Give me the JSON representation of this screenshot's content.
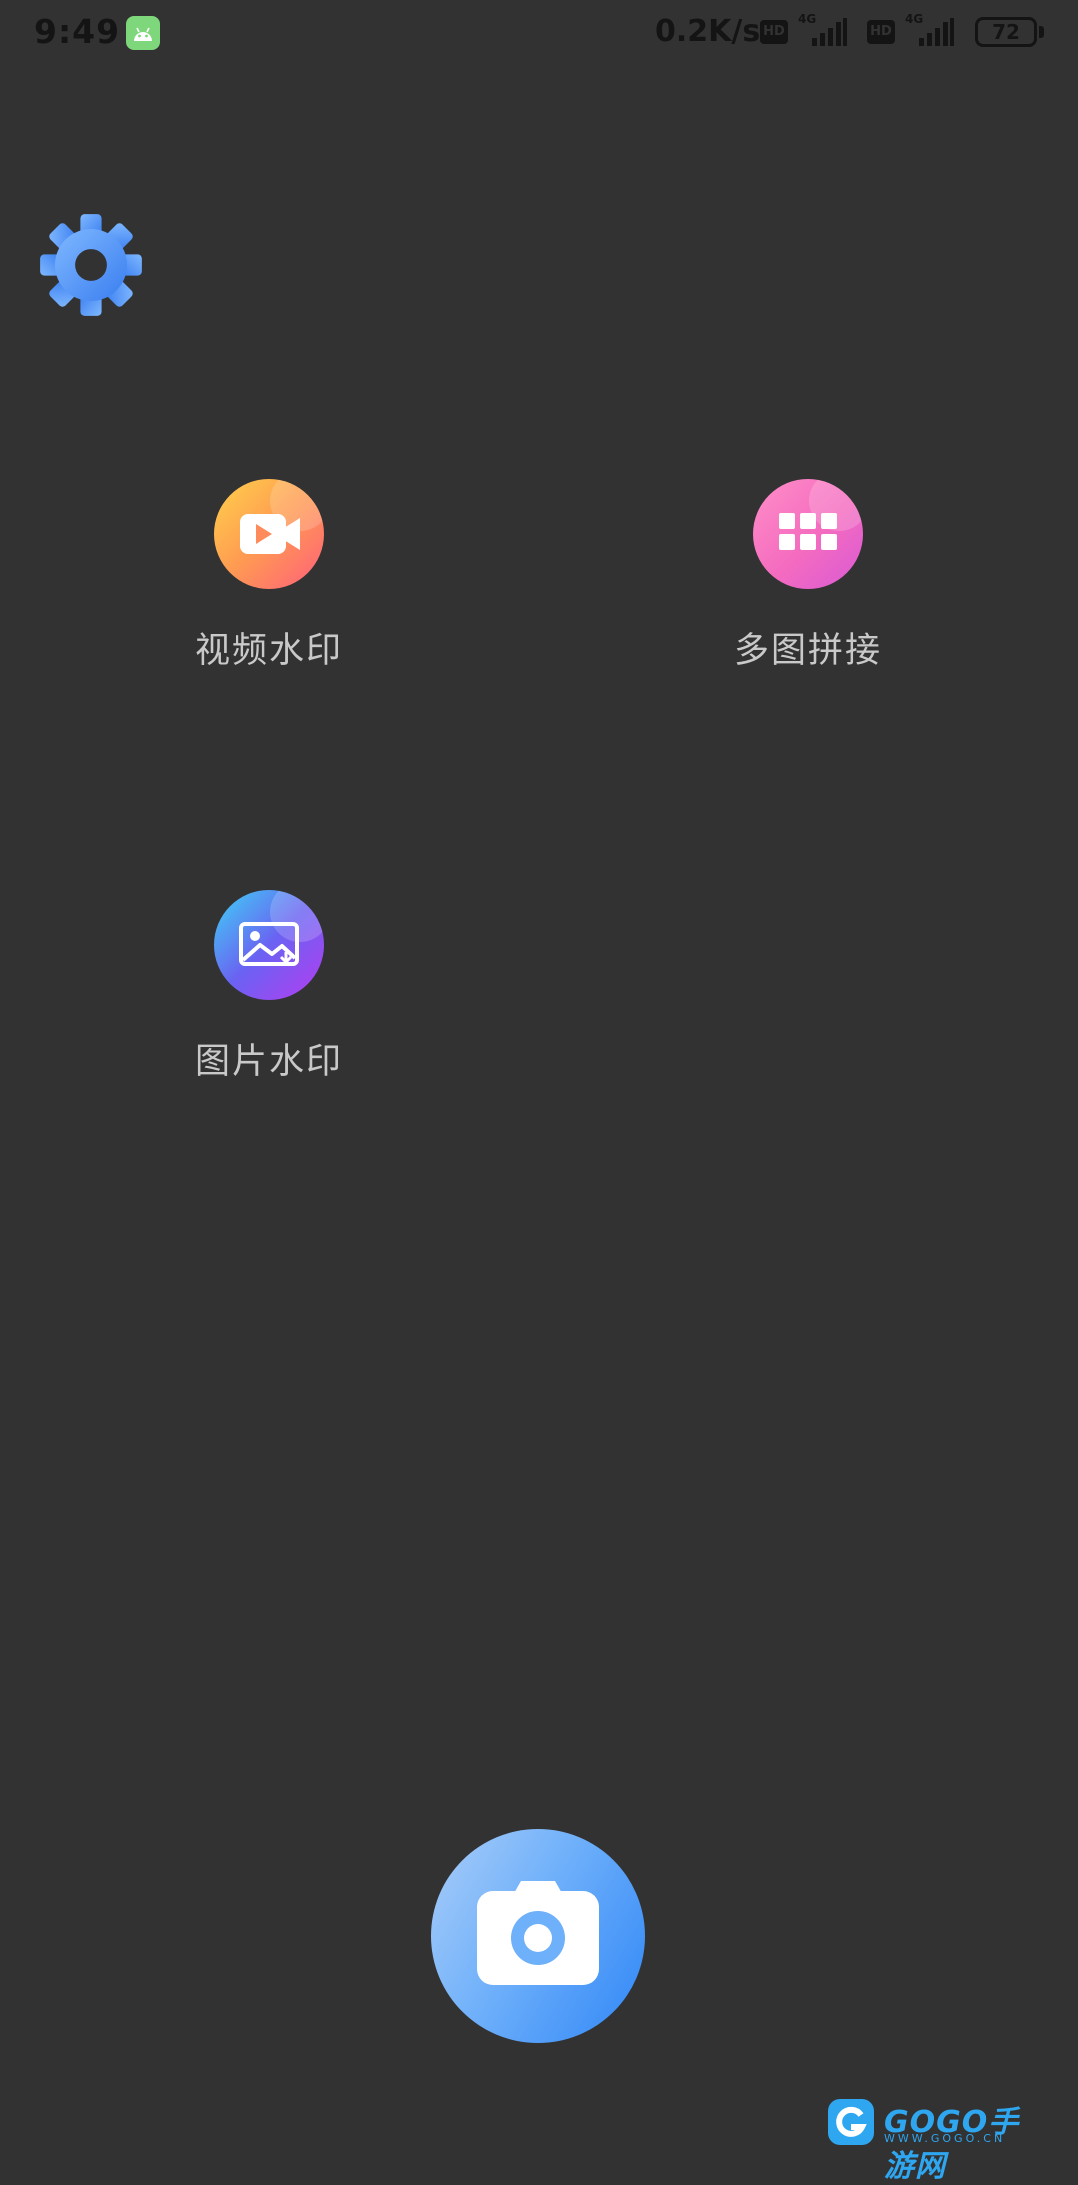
{
  "status_bar": {
    "time": "9:49",
    "app_notification_icon": "android-icon",
    "net_speed": "0.2K/s",
    "sim1": {
      "hd": "HD",
      "network": "4G"
    },
    "sim2": {
      "hd": "HD",
      "network": "4G"
    },
    "battery_level": "72"
  },
  "settings": {
    "icon": "gear-icon"
  },
  "features": {
    "video_watermark": {
      "label": "视频水印",
      "icon": "video-camera-icon"
    },
    "collage": {
      "label": "多图拼接",
      "icon": "grid-icon"
    },
    "photo_watermark": {
      "label": "图片水印",
      "icon": "image-icon"
    }
  },
  "camera": {
    "icon": "camera-icon"
  },
  "watermark": {
    "logo_text": "GOGO手游网",
    "logo_sub": "WWW.GOGO.CN"
  },
  "colors": {
    "background": "#323232",
    "video_gradient": [
      "#ffd24a",
      "#ff5f7c"
    ],
    "collage_gradient": [
      "#ff8ec8",
      "#d95ad6"
    ],
    "photo_gradient": [
      "#3dd4f5",
      "#b63cf0"
    ],
    "camera_gradient": [
      "#a9cdf8",
      "#2f86f7"
    ],
    "settings_gear": "#5a9cf5"
  }
}
